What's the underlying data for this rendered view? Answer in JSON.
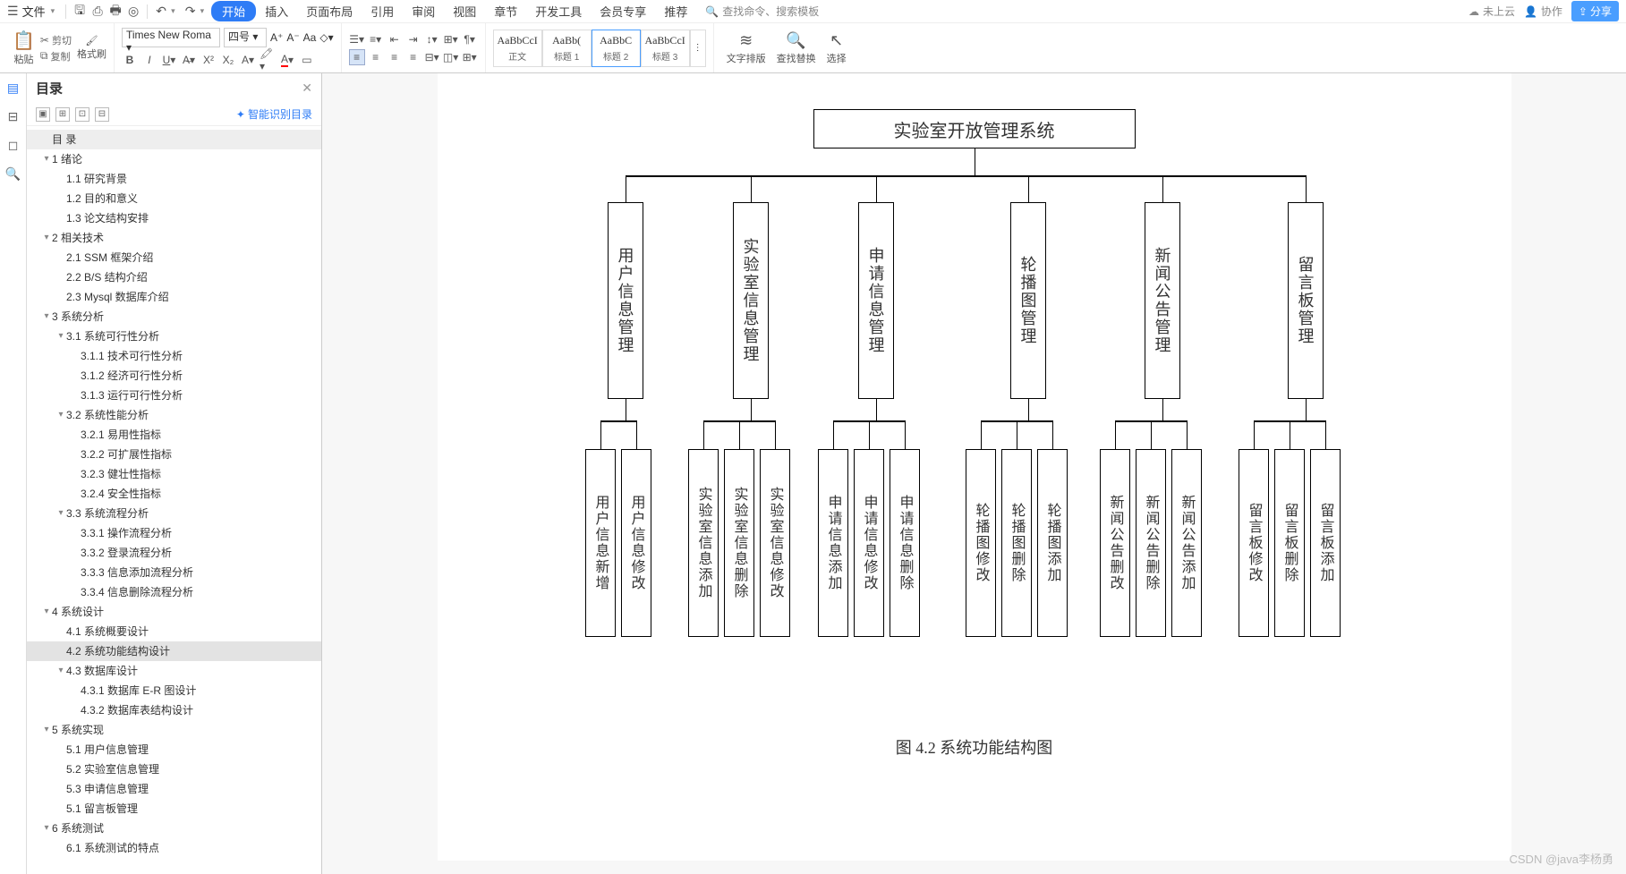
{
  "menubar": {
    "file_label": "文件",
    "tabs": [
      "开始",
      "插入",
      "页面布局",
      "引用",
      "审阅",
      "视图",
      "章节",
      "开发工具",
      "会员专享",
      "推荐"
    ],
    "active_tab": 0,
    "search_placeholder": "查找命令、搜索模板",
    "cloud_label": "未上云",
    "collab_label": "协作",
    "share_label": "分享"
  },
  "ribbon": {
    "paste_label": "粘贴",
    "cut_label": "剪切",
    "copy_label": "复制",
    "brush_label": "格式刷",
    "font_name": "Times New Roma",
    "font_size": "四号",
    "styles": [
      {
        "preview": "AaBbCcI",
        "label": "正文"
      },
      {
        "preview": "AaBb(",
        "label": "标题 1"
      },
      {
        "preview": "AaBbC",
        "label": "标题 2"
      },
      {
        "preview": "AaBbCcI",
        "label": "标题 3"
      }
    ],
    "text_layout_label": "文字排版",
    "find_replace_label": "查找替换",
    "select_label": "选择"
  },
  "outline": {
    "title": "目录",
    "smart_label": "智能识别目录",
    "tree": [
      {
        "lvl": 0,
        "tw": "",
        "txt": "目 录"
      },
      {
        "lvl": 1,
        "tw": "▾",
        "txt": "1 绪论"
      },
      {
        "lvl": 2,
        "tw": "",
        "txt": "1.1 研究背景"
      },
      {
        "lvl": 2,
        "tw": "",
        "txt": "1.2 目的和意义"
      },
      {
        "lvl": 2,
        "tw": "",
        "txt": "1.3 论文结构安排"
      },
      {
        "lvl": 1,
        "tw": "▾",
        "txt": "2 相关技术"
      },
      {
        "lvl": 2,
        "tw": "",
        "txt": "2.1 SSM 框架介绍"
      },
      {
        "lvl": 2,
        "tw": "",
        "txt": "2.2 B/S 结构介绍"
      },
      {
        "lvl": 2,
        "tw": "",
        "txt": "2.3 Mysql 数据库介绍"
      },
      {
        "lvl": 1,
        "tw": "▾",
        "txt": "3 系统分析"
      },
      {
        "lvl": 2,
        "tw": "▾",
        "txt": "3.1 系统可行性分析"
      },
      {
        "lvl": 3,
        "tw": "",
        "txt": "3.1.1 技术可行性分析"
      },
      {
        "lvl": 3,
        "tw": "",
        "txt": "3.1.2 经济可行性分析"
      },
      {
        "lvl": 3,
        "tw": "",
        "txt": "3.1.3 运行可行性分析"
      },
      {
        "lvl": 2,
        "tw": "▾",
        "txt": "3.2 系统性能分析"
      },
      {
        "lvl": 3,
        "tw": "",
        "txt": "3.2.1 易用性指标"
      },
      {
        "lvl": 3,
        "tw": "",
        "txt": "3.2.2 可扩展性指标"
      },
      {
        "lvl": 3,
        "tw": "",
        "txt": "3.2.3 健壮性指标"
      },
      {
        "lvl": 3,
        "tw": "",
        "txt": "3.2.4 安全性指标"
      },
      {
        "lvl": 2,
        "tw": "▾",
        "txt": "3.3 系统流程分析"
      },
      {
        "lvl": 3,
        "tw": "",
        "txt": "3.3.1 操作流程分析"
      },
      {
        "lvl": 3,
        "tw": "",
        "txt": "3.3.2 登录流程分析"
      },
      {
        "lvl": 3,
        "tw": "",
        "txt": "3.3.3 信息添加流程分析"
      },
      {
        "lvl": 3,
        "tw": "",
        "txt": "3.3.4 信息删除流程分析"
      },
      {
        "lvl": 1,
        "tw": "▾",
        "txt": "4 系统设计"
      },
      {
        "lvl": 2,
        "tw": "",
        "txt": "4.1 系统概要设计"
      },
      {
        "lvl": 2,
        "tw": "",
        "txt": "4.2 系统功能结构设计",
        "selected": true
      },
      {
        "lvl": 2,
        "tw": "▾",
        "txt": "4.3 数据库设计"
      },
      {
        "lvl": 3,
        "tw": "",
        "txt": "4.3.1 数据库 E-R 图设计"
      },
      {
        "lvl": 3,
        "tw": "",
        "txt": "4.3.2 数据库表结构设计"
      },
      {
        "lvl": 1,
        "tw": "▾",
        "txt": "5 系统实现"
      },
      {
        "lvl": 2,
        "tw": "",
        "txt": "5.1 用户信息管理"
      },
      {
        "lvl": 2,
        "tw": "",
        "txt": "5.2 实验室信息管理"
      },
      {
        "lvl": 2,
        "tw": "",
        "txt": "5.3 申请信息管理"
      },
      {
        "lvl": 2,
        "tw": "",
        "txt": "5.1 留言板管理"
      },
      {
        "lvl": 1,
        "tw": "▾",
        "txt": "6 系统测试"
      },
      {
        "lvl": 2,
        "tw": "",
        "txt": "6.1 系统测试的特点"
      }
    ]
  },
  "chart_data": {
    "type": "tree",
    "root": "实验室开放管理系统",
    "level2": [
      "用户信息管理",
      "实验室信息管理",
      "申请信息管理",
      "轮播图管理",
      "新闻公告管理",
      "留言板管理"
    ],
    "level3": [
      [
        "用户信息新增",
        "用户信息修改"
      ],
      [
        "实验室信息添加",
        "实验室信息删除",
        "实验室信息修改"
      ],
      [
        "申请信息添加",
        "申请信息修改",
        "申请信息删除"
      ],
      [
        "轮播图修改",
        "轮播图删除",
        "轮播图添加"
      ],
      [
        "新闻公告删改",
        "新闻公告删除",
        "新闻公告添加"
      ],
      [
        "留言板修改",
        "留言板删除",
        "留言板添加"
      ]
    ],
    "caption": "图 4.2  系统功能结构图"
  },
  "watermark": "CSDN @java李杨勇"
}
